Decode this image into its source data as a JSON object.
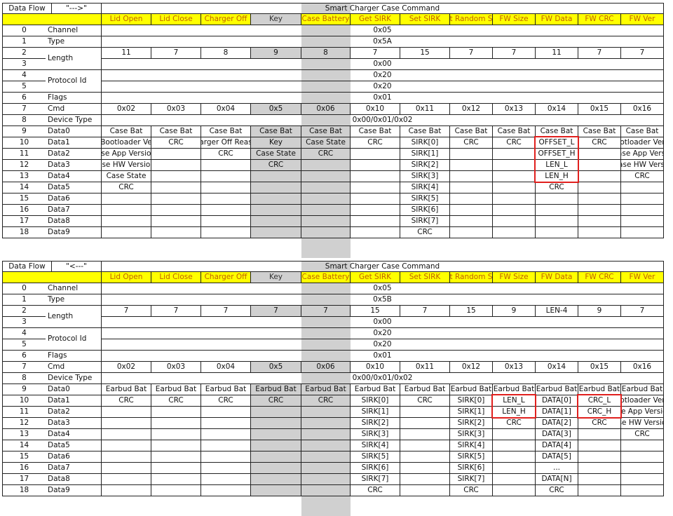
{
  "colors": {
    "header_fill": "#ffff00",
    "header_text": "#c06000",
    "key_column_fill": "#d0d0d0",
    "highlight_border": "#e0201e",
    "grid_line": "#222222"
  },
  "tables": [
    {
      "flow_label": "Data Flow",
      "flow_arrow": "\"--->\"",
      "title": "Smart Charger Case Command",
      "columns": [
        "Lid Open",
        "Lid Close",
        "Charger Off",
        "Key",
        "Case Battery",
        "Get SIRK",
        "Set SIRK",
        "t Random S",
        "FW Size",
        "FW Data",
        "FW CRC",
        "FW Ver"
      ],
      "rows": [
        {
          "idx": "0",
          "name": "Channel",
          "span": "0x05"
        },
        {
          "idx": "1",
          "name": "Type",
          "span": "0x5A"
        },
        {
          "idx": "2",
          "name": "Length",
          "cells": [
            "11",
            "7",
            "8",
            "9",
            "8",
            "7",
            "15",
            "7",
            "7",
            "11",
            "7",
            "7"
          ]
        },
        {
          "idx": "3",
          "name": "",
          "span": "0x00"
        },
        {
          "idx": "4",
          "name": "Protocol Id",
          "span": "0x20"
        },
        {
          "idx": "5",
          "name": "",
          "span": "0x20"
        },
        {
          "idx": "6",
          "name": "Flags",
          "span": "0x01"
        },
        {
          "idx": "7",
          "name": "Cmd",
          "cells": [
            "0x02",
            "0x03",
            "0x04",
            "0x5",
            "0x06",
            "0x10",
            "0x11",
            "0x12",
            "0x13",
            "0x14",
            "0x15",
            "0x16"
          ]
        },
        {
          "idx": "8",
          "name": "Device Type",
          "span": "0x00/0x01/0x02"
        },
        {
          "idx": "9",
          "name": "Data0",
          "cells": [
            "Case Bat",
            "Case Bat",
            "Case Bat",
            "Case Bat",
            "Case Bat",
            "Case Bat",
            "Case Bat",
            "Case Bat",
            "Case Bat",
            "Case Bat",
            "Case Bat",
            "Case Bat"
          ]
        },
        {
          "idx": "10",
          "name": "Data1",
          "cells": [
            "Bootloader Ve",
            "CRC",
            "arger Off Reas",
            "Key",
            "Case State",
            "CRC",
            "SIRK[0]",
            "CRC",
            "CRC",
            "OFFSET_L",
            "CRC",
            "ootloader Vers"
          ]
        },
        {
          "idx": "11",
          "name": "Data2",
          "cells": [
            "ase App Version",
            "",
            "CRC",
            "Case State",
            "CRC",
            "",
            "SIRK[1]",
            "",
            "",
            "OFFSET_H",
            "",
            "Case App Versio"
          ]
        },
        {
          "idx": "12",
          "name": "Data3",
          "cells": [
            "ase HW Version",
            "",
            "",
            "CRC",
            "",
            "",
            "SIRK[2]",
            "",
            "",
            "LEN_L",
            "",
            "Case HW Versio"
          ]
        },
        {
          "idx": "13",
          "name": "Data4",
          "cells": [
            "Case State",
            "",
            "",
            "",
            "",
            "",
            "SIRK[3]",
            "",
            "",
            "LEN_H",
            "",
            "CRC"
          ]
        },
        {
          "idx": "14",
          "name": "Data5",
          "cells": [
            "CRC",
            "",
            "",
            "",
            "",
            "",
            "SIRK[4]",
            "",
            "",
            "CRC",
            "",
            ""
          ]
        },
        {
          "idx": "15",
          "name": "Data6",
          "cells": [
            "",
            "",
            "",
            "",
            "",
            "",
            "SIRK[5]",
            "",
            "",
            "",
            "",
            ""
          ]
        },
        {
          "idx": "16",
          "name": "Data7",
          "cells": [
            "",
            "",
            "",
            "",
            "",
            "",
            "SIRK[6]",
            "",
            "",
            "",
            "",
            ""
          ]
        },
        {
          "idx": "17",
          "name": "Data8",
          "cells": [
            "",
            "",
            "",
            "",
            "",
            "",
            "SIRK[7]",
            "",
            "",
            "",
            "",
            ""
          ]
        },
        {
          "idx": "18",
          "name": "Data9",
          "cells": [
            "",
            "",
            "",
            "",
            "",
            "",
            "CRC",
            "",
            "",
            "",
            "",
            ""
          ]
        }
      ]
    },
    {
      "flow_label": "Data Flow",
      "flow_arrow": "\"<---\"",
      "title": "Smart Charger Case Command",
      "columns": [
        "Lid Open",
        "Lid Close",
        "Charger Off",
        "Key",
        "Case Battery",
        "Get SIRK",
        "Set SIRK",
        "t Random S",
        "FW Size",
        "FW Data",
        "FW CRC",
        "FW Ver"
      ],
      "rows": [
        {
          "idx": "0",
          "name": "Channel",
          "span": "0x05"
        },
        {
          "idx": "1",
          "name": "Type",
          "span": "0x5B"
        },
        {
          "idx": "2",
          "name": "Length",
          "cells": [
            "7",
            "7",
            "7",
            "7",
            "7",
            "15",
            "7",
            "15",
            "9",
            "LEN-4",
            "9",
            "7"
          ]
        },
        {
          "idx": "3",
          "name": "",
          "span": "0x00"
        },
        {
          "idx": "4",
          "name": "Protocol Id",
          "span": "0x20"
        },
        {
          "idx": "5",
          "name": "",
          "span": "0x20"
        },
        {
          "idx": "6",
          "name": "Flags",
          "span": "0x01"
        },
        {
          "idx": "7",
          "name": "Cmd",
          "cells": [
            "0x02",
            "0x03",
            "0x04",
            "0x5",
            "0x06",
            "0x10",
            "0x11",
            "0x12",
            "0x13",
            "0x14",
            "0x15",
            "0x16"
          ]
        },
        {
          "idx": "8",
          "name": "Device Type",
          "span": "0x00/0x01/0x02"
        },
        {
          "idx": "9",
          "name": "Data0",
          "cells": [
            "Earbud Bat",
            "Earbud Bat",
            "Earbud Bat",
            "Earbud Bat",
            "Earbud Bat",
            "Earbud Bat",
            "Earbud Bat",
            "Earbud Bat",
            "Earbud Bat",
            "Earbud Bat",
            "Earbud Bat",
            "Earbud Bat"
          ]
        },
        {
          "idx": "10",
          "name": "Data1",
          "cells": [
            "CRC",
            "CRC",
            "CRC",
            "CRC",
            "CRC",
            "SIRK[0]",
            "CRC",
            "SIRK[0]",
            "LEN_L",
            "DATA[0]",
            "CRC_L",
            "ootloader Vers"
          ]
        },
        {
          "idx": "11",
          "name": "Data2",
          "cells": [
            "",
            "",
            "",
            "",
            "",
            "SIRK[1]",
            "",
            "SIRK[1]",
            "LEN_H",
            "DATA[1]",
            "CRC_H",
            "se App Versio"
          ]
        },
        {
          "idx": "12",
          "name": "Data3",
          "cells": [
            "",
            "",
            "",
            "",
            "",
            "SIRK[2]",
            "",
            "SIRK[2]",
            "CRC",
            "DATA[2]",
            "CRC",
            "se HW Versio"
          ]
        },
        {
          "idx": "13",
          "name": "Data4",
          "cells": [
            "",
            "",
            "",
            "",
            "",
            "SIRK[3]",
            "",
            "SIRK[3]",
            "",
            "DATA[3]",
            "",
            "CRC"
          ]
        },
        {
          "idx": "14",
          "name": "Data5",
          "cells": [
            "",
            "",
            "",
            "",
            "",
            "SIRK[4]",
            "",
            "SIRK[4]",
            "",
            "DATA[4]",
            "",
            ""
          ]
        },
        {
          "idx": "15",
          "name": "Data6",
          "cells": [
            "",
            "",
            "",
            "",
            "",
            "SIRK[5]",
            "",
            "SIRK[5]",
            "",
            "DATA[5]",
            "",
            ""
          ]
        },
        {
          "idx": "16",
          "name": "Data7",
          "cells": [
            "",
            "",
            "",
            "",
            "",
            "SIRK[6]",
            "",
            "SIRK[6]",
            "",
            "...",
            "",
            ""
          ]
        },
        {
          "idx": "17",
          "name": "Data8",
          "cells": [
            "",
            "",
            "",
            "",
            "",
            "SIRK[7]",
            "",
            "SIRK[7]",
            "",
            "DATA[N]",
            "",
            ""
          ]
        },
        {
          "idx": "18",
          "name": "Data9",
          "cells": [
            "",
            "",
            "",
            "",
            "",
            "CRC",
            "",
            "CRC",
            "",
            "CRC",
            "",
            ""
          ]
        }
      ]
    }
  ]
}
